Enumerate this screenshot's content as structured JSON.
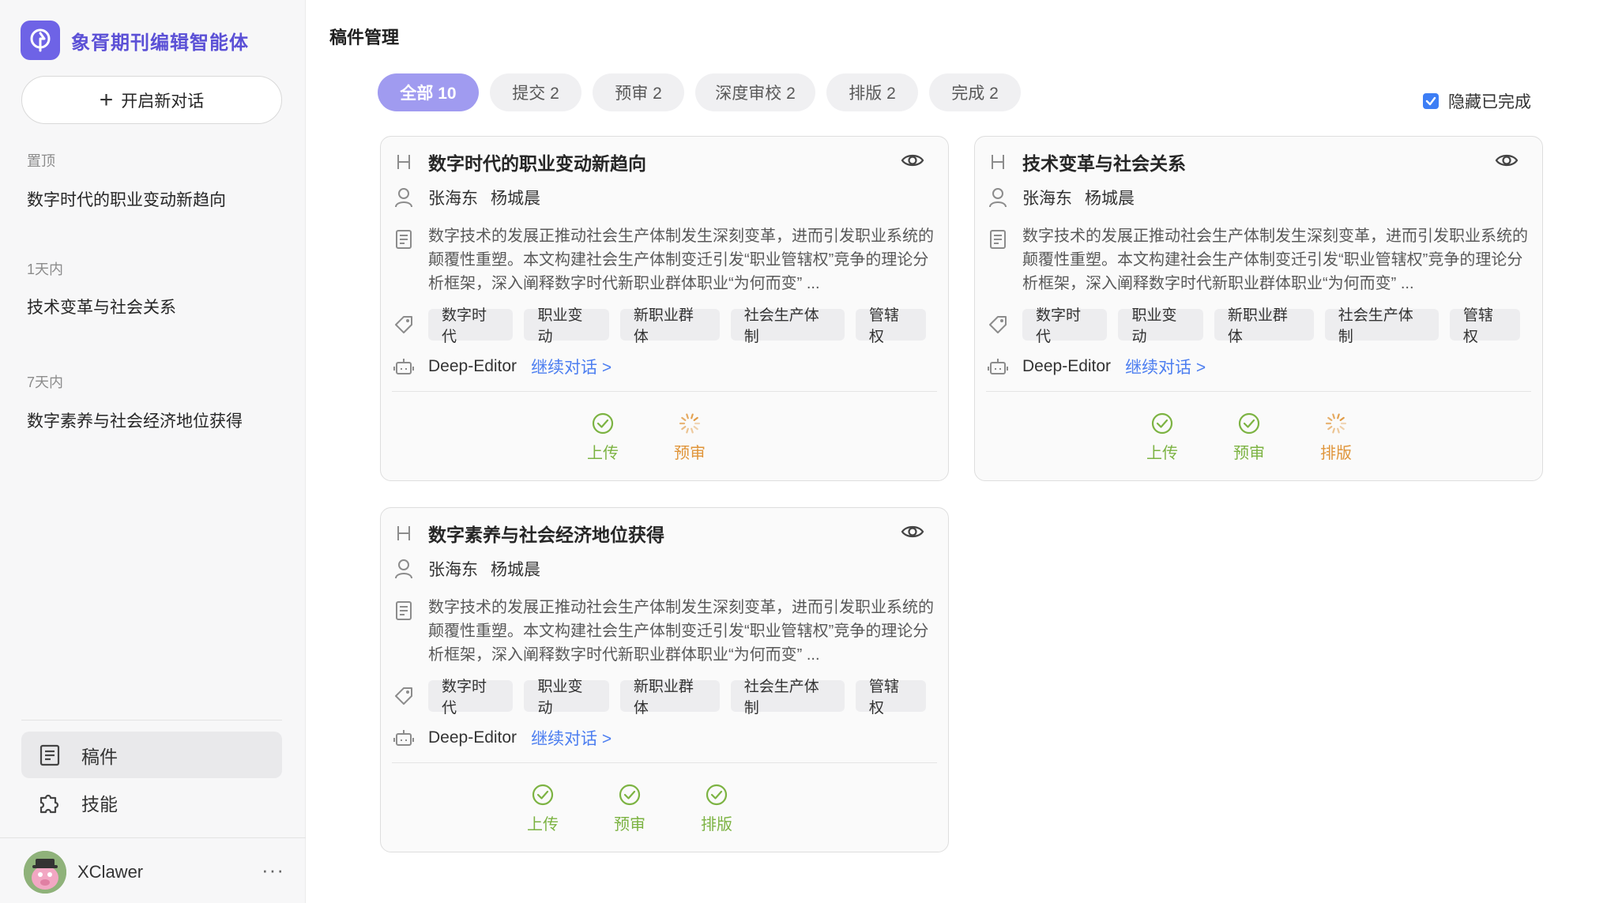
{
  "app": {
    "name": "象胥期刊编辑智能体",
    "new_chat_label": "开启新对话"
  },
  "history": [
    {
      "group": "置顶",
      "item": "数字时代的职业变动新趋向"
    },
    {
      "group": "1天内",
      "item": "技术变革与社会关系"
    },
    {
      "group": "7天内",
      "item": "数字素养与社会经济地位获得"
    }
  ],
  "nav": [
    {
      "label": "稿件",
      "icon": "document-icon",
      "active": true
    },
    {
      "label": "技能",
      "icon": "puzzle-icon",
      "active": false
    }
  ],
  "user": {
    "name": "XClawer",
    "more": "···"
  },
  "page": {
    "title": "稿件管理"
  },
  "tabs": [
    {
      "label": "全部 10",
      "active": true
    },
    {
      "label": "提交 2",
      "active": false
    },
    {
      "label": "预审 2",
      "active": false
    },
    {
      "label": "深度审校 2",
      "active": false
    },
    {
      "label": "排版 2",
      "active": false
    },
    {
      "label": "完成 2",
      "active": false
    }
  ],
  "filter": {
    "hide_completed_label": "隐藏已完成",
    "hide_completed": true
  },
  "colors": {
    "accent": "#6e63e6",
    "tab_active": "#a09bf0",
    "link": "#4c7ef0",
    "done": "#7cb342",
    "pending": "#e0953a"
  },
  "cards": [
    {
      "title": "数字时代的职业变动新趋向",
      "authors": [
        "张海东",
        "杨城晨"
      ],
      "abstract": "数字技术的发展正推动社会生产体制发生深刻变革，进而引发职业系统的颠覆性重塑。本文构建社会生产体制变迁引发“职业管辖权”竞争的理论分析框架，深入阐释数字时代新职业群体职业“为何而变” ...",
      "tags": [
        "数字时代",
        "职业变动",
        "新职业群体",
        "社会生产体制",
        "管辖权"
      ],
      "agent": "Deep-Editor",
      "continue_label": "继续对话 >",
      "stages": [
        {
          "label": "上传",
          "status": "done"
        },
        {
          "label": "预审",
          "status": "pending"
        }
      ]
    },
    {
      "title": "技术变革与社会关系",
      "authors": [
        "张海东",
        "杨城晨"
      ],
      "abstract": "数字技术的发展正推动社会生产体制发生深刻变革，进而引发职业系统的颠覆性重塑。本文构建社会生产体制变迁引发“职业管辖权”竞争的理论分析框架，深入阐释数字时代新职业群体职业“为何而变” ...",
      "tags": [
        "数字时代",
        "职业变动",
        "新职业群体",
        "社会生产体制",
        "管辖权"
      ],
      "agent": "Deep-Editor",
      "continue_label": "继续对话 >",
      "stages": [
        {
          "label": "上传",
          "status": "done"
        },
        {
          "label": "预审",
          "status": "done"
        },
        {
          "label": "排版",
          "status": "pending"
        }
      ]
    },
    {
      "title": "数字素养与社会经济地位获得",
      "authors": [
        "张海东",
        "杨城晨"
      ],
      "abstract": "数字技术的发展正推动社会生产体制发生深刻变革，进而引发职业系统的颠覆性重塑。本文构建社会生产体制变迁引发“职业管辖权”竞争的理论分析框架，深入阐释数字时代新职业群体职业“为何而变” ...",
      "tags": [
        "数字时代",
        "职业变动",
        "新职业群体",
        "社会生产体制",
        "管辖权"
      ],
      "agent": "Deep-Editor",
      "continue_label": "继续对话 >",
      "stages": [
        {
          "label": "上传",
          "status": "done"
        },
        {
          "label": "预审",
          "status": "done"
        },
        {
          "label": "排版",
          "status": "done"
        }
      ]
    }
  ]
}
